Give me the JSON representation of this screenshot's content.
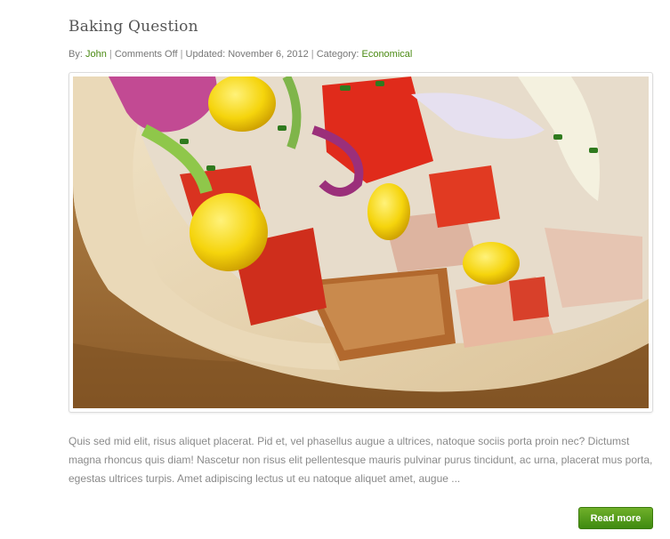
{
  "post": {
    "title": "Baking Question",
    "meta": {
      "by_label": "By:",
      "author": "John",
      "comments": "Comments Off",
      "updated_label": "Updated:",
      "updated_date": "November 6, 2012",
      "category_label": "Category:",
      "category": "Economical"
    },
    "image": {
      "subject": "chicken pita wrap with tomato, corn, cabbage and herbs"
    },
    "excerpt": "Quis sed mid elit, risus aliquet placerat. Pid et, vel phasellus augue a ultrices, natoque sociis porta proin nec? Dictumst magna rhoncus quis diam! Nascetur non risus elit pellentesque mauris pulvinar purus tincidunt, ac urna, placerat mus porta, egestas ultrices turpis. Amet adipiscing lectus ut eu natoque aliquet amet, augue ...",
    "read_more": "Read more"
  },
  "colors": {
    "link": "#4a8a12",
    "button_top": "#6fb02a",
    "button_bottom": "#3f8a10",
    "text": "#8a8a8a",
    "title": "#555555"
  }
}
